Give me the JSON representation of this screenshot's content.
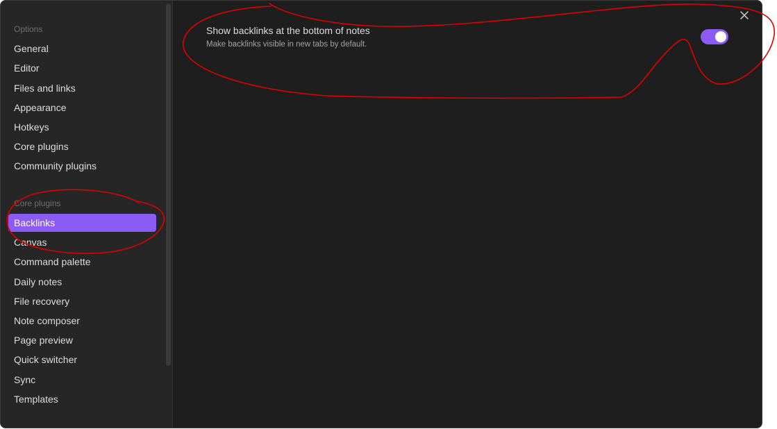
{
  "colors": {
    "accent": "#8a5cf5",
    "background": "#1e1e1e",
    "sidebar_background": "#262626",
    "annotation": "#e00000"
  },
  "sidebar": {
    "options_heading": "Options",
    "options": [
      {
        "label": "General"
      },
      {
        "label": "Editor"
      },
      {
        "label": "Files and links"
      },
      {
        "label": "Appearance"
      },
      {
        "label": "Hotkeys"
      },
      {
        "label": "Core plugins"
      },
      {
        "label": "Community plugins"
      }
    ],
    "core_heading": "Core plugins",
    "core_plugins": [
      {
        "label": "Backlinks",
        "active": true
      },
      {
        "label": "Canvas"
      },
      {
        "label": "Command palette"
      },
      {
        "label": "Daily notes"
      },
      {
        "label": "File recovery"
      },
      {
        "label": "Note composer"
      },
      {
        "label": "Page preview"
      },
      {
        "label": "Quick switcher"
      },
      {
        "label": "Sync"
      },
      {
        "label": "Templates"
      }
    ]
  },
  "content": {
    "close_icon": "close-icon",
    "setting": {
      "name": "Show backlinks at the bottom of notes",
      "description": "Make backlinks visible in new tabs by default.",
      "enabled": true
    }
  }
}
